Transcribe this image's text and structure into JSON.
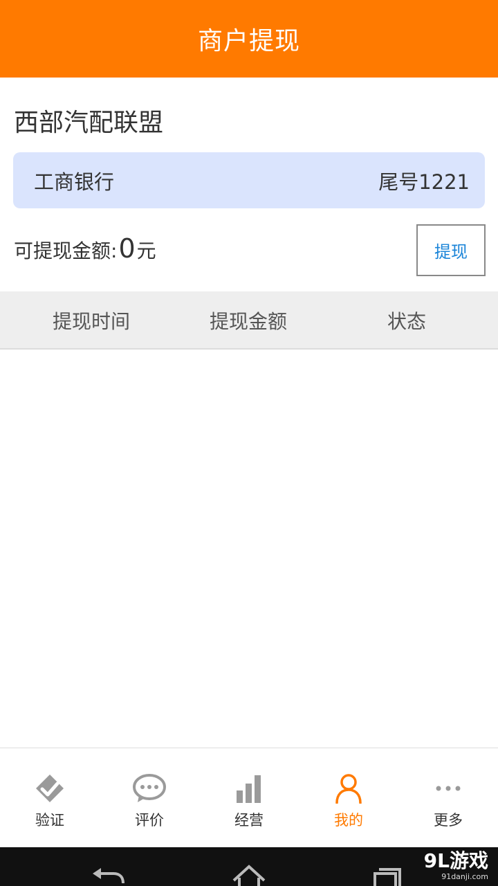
{
  "header": {
    "title": "商户提现"
  },
  "merchant": {
    "name": "西部汽配联盟"
  },
  "bank_card": {
    "bank_name": "工商银行",
    "tail_label": "尾号1221"
  },
  "balance": {
    "label": "可提现金额:",
    "amount": "0",
    "unit": "元"
  },
  "withdraw_button": {
    "label": "提现"
  },
  "table": {
    "columns": [
      "提现时间",
      "提现金额",
      "状态"
    ],
    "rows": []
  },
  "tabbar": {
    "items": [
      {
        "label": "验证",
        "icon": "verify-icon",
        "active": false
      },
      {
        "label": "评价",
        "icon": "chat-bubble-icon",
        "active": false
      },
      {
        "label": "经营",
        "icon": "bar-chart-icon",
        "active": false
      },
      {
        "label": "我的",
        "icon": "person-icon",
        "active": true
      },
      {
        "label": "更多",
        "icon": "more-dots-icon",
        "active": false
      }
    ]
  },
  "watermark": {
    "main": "9L游戏",
    "sub": "91danji.com"
  },
  "colors": {
    "brand": "#ff7a00",
    "card_bg": "#dae4fd",
    "link": "#1a84d8",
    "inactive_icon": "#9a9a9a"
  }
}
